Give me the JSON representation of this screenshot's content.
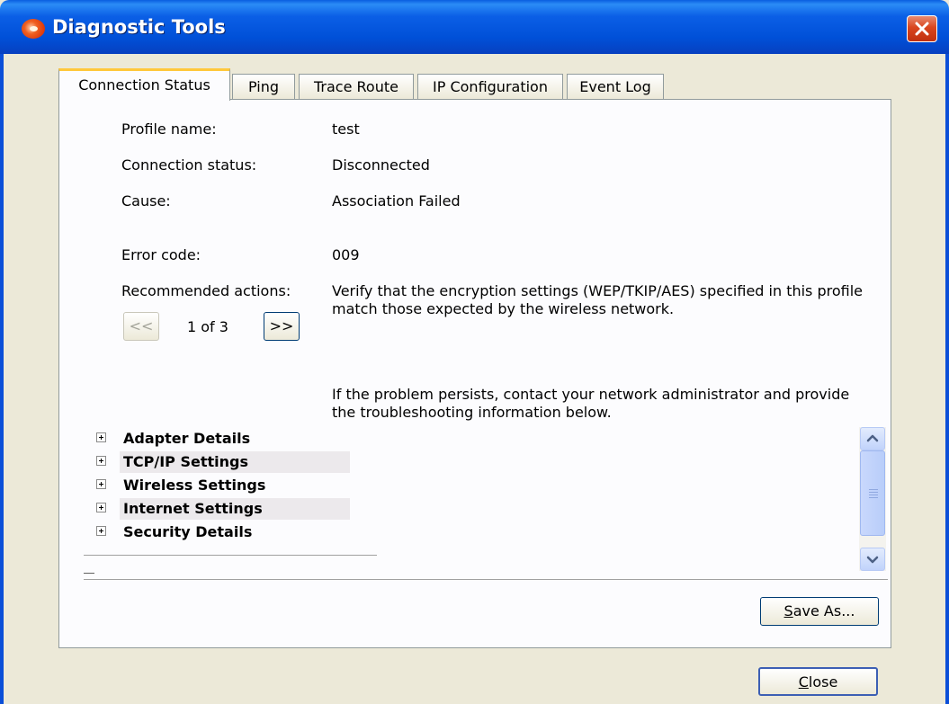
{
  "window": {
    "title": "Diagnostic Tools"
  },
  "tabs": [
    {
      "label": "Connection Status",
      "active": true
    },
    {
      "label": "Ping"
    },
    {
      "label": "Trace Route"
    },
    {
      "label": "IP Configuration"
    },
    {
      "label": "Event Log"
    }
  ],
  "status": {
    "profile_name_label": "Profile name:",
    "profile_name_value": "test",
    "connection_status_label": "Connection status:",
    "connection_status_value": "Disconnected",
    "cause_label": "Cause:",
    "cause_value": "Association Failed",
    "error_code_label": "Error code:",
    "error_code_value": "009",
    "recommended_label": "Recommended actions:",
    "recommended_text": "Verify that the encryption settings (WEP/TKIP/AES) specified in this profile match those expected by the wireless network."
  },
  "pager": {
    "prev_label": "<<",
    "next_label": ">>",
    "position": "1 of 3"
  },
  "persist_note": "If the problem persists, contact your network administrator and provide the troubleshooting information below.",
  "details": [
    "Adapter Details",
    "TCP/IP Settings",
    "Wireless Settings",
    "Internet Settings",
    "Security Details"
  ],
  "buttons": {
    "save_as_prefix": "S",
    "save_as_rest": "ave As...",
    "close_prefix": "C",
    "close_rest": "lose"
  },
  "colors": {
    "titlebar": "#0050d8",
    "close_button": "#d9451e",
    "tab_highlight": "#ffc83c",
    "window_bg": "#ece9d8"
  },
  "icons": {
    "app": "diagnostic-app-icon",
    "close": "close-x-icon",
    "expand": "plus-box-icon"
  }
}
